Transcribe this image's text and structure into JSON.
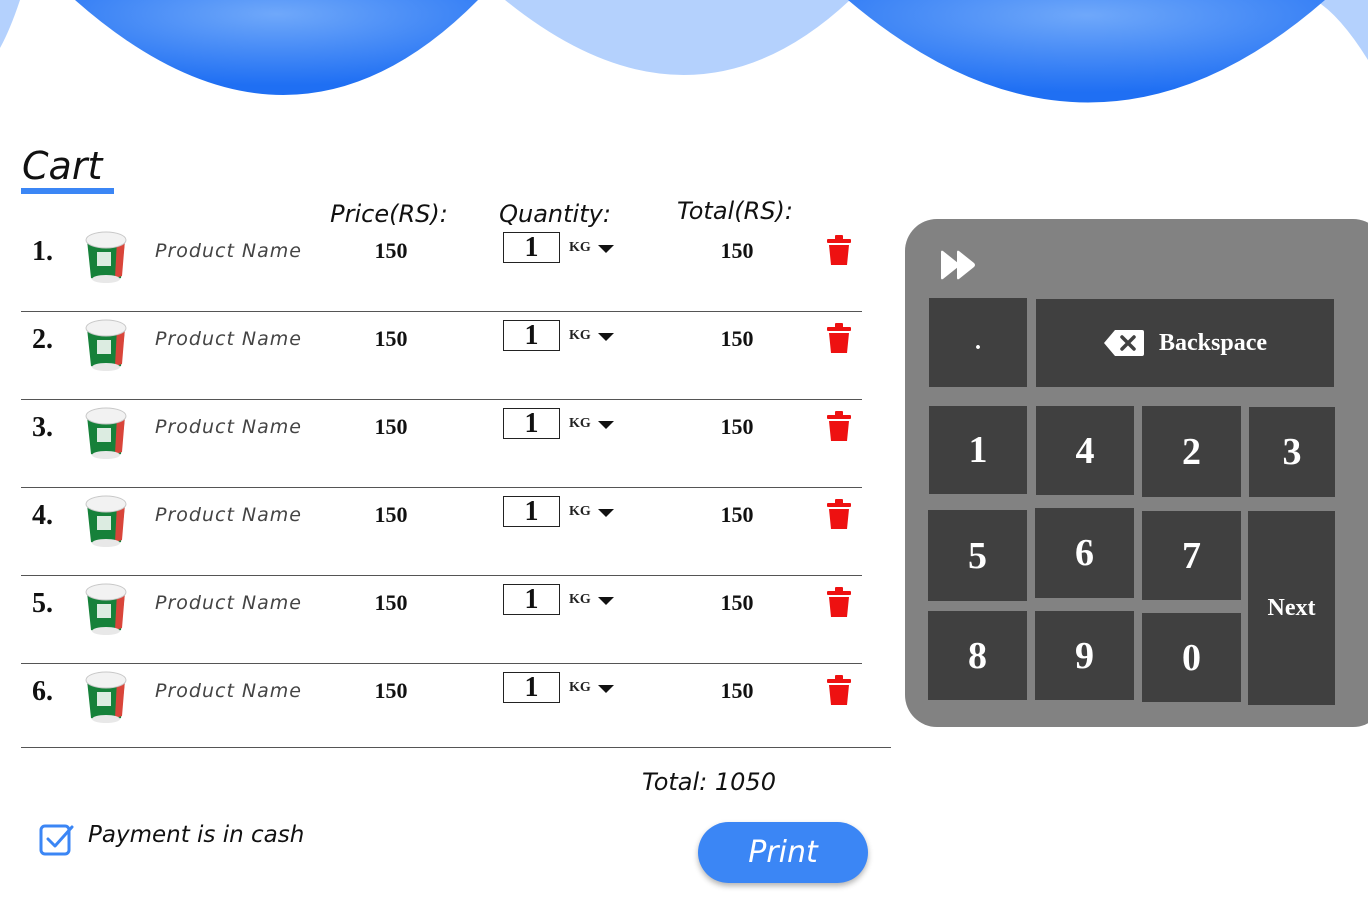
{
  "cart": {
    "title": "Cart",
    "headers": {
      "price": "Price(RS):",
      "quantity": "Quantity:",
      "total": "Total(RS):"
    },
    "items": [
      {
        "index": "1.",
        "name": "Product Name",
        "price": "150",
        "qty": "1",
        "unit": "KG",
        "total": "150"
      },
      {
        "index": "2.",
        "name": "Product Name",
        "price": "150",
        "qty": "1",
        "unit": "KG",
        "total": "150"
      },
      {
        "index": "3.",
        "name": "Product Name",
        "price": "150",
        "qty": "1",
        "unit": "KG",
        "total": "150"
      },
      {
        "index": "4.",
        "name": "Product Name",
        "price": "150",
        "qty": "1",
        "unit": "KG",
        "total": "150"
      },
      {
        "index": "5.",
        "name": "Product Name",
        "price": "150",
        "qty": "1",
        "unit": "KG",
        "total": "150"
      },
      {
        "index": "6.",
        "name": "Product Name",
        "price": "150",
        "qty": "1",
        "unit": "KG",
        "total": "150"
      }
    ],
    "grand_total": "Total: 1050",
    "payment_cash_label": "Payment is in cash",
    "payment_cash_checked": true,
    "print_label": "Print"
  },
  "keypad": {
    "icon": "fast-forward-icon",
    "dot": ".",
    "backspace": "Backspace",
    "next": "Next",
    "digits": [
      "1",
      "4",
      "2",
      "3",
      "5",
      "6",
      "7",
      "8",
      "9",
      "0"
    ]
  },
  "colors": {
    "accent": "#3b86f5",
    "wave_dark": "#2a7cf6",
    "wave_light": "#b4d1fd",
    "delete": "#ee1111",
    "keypad_bg": "#828282",
    "key_bg": "#404040"
  }
}
